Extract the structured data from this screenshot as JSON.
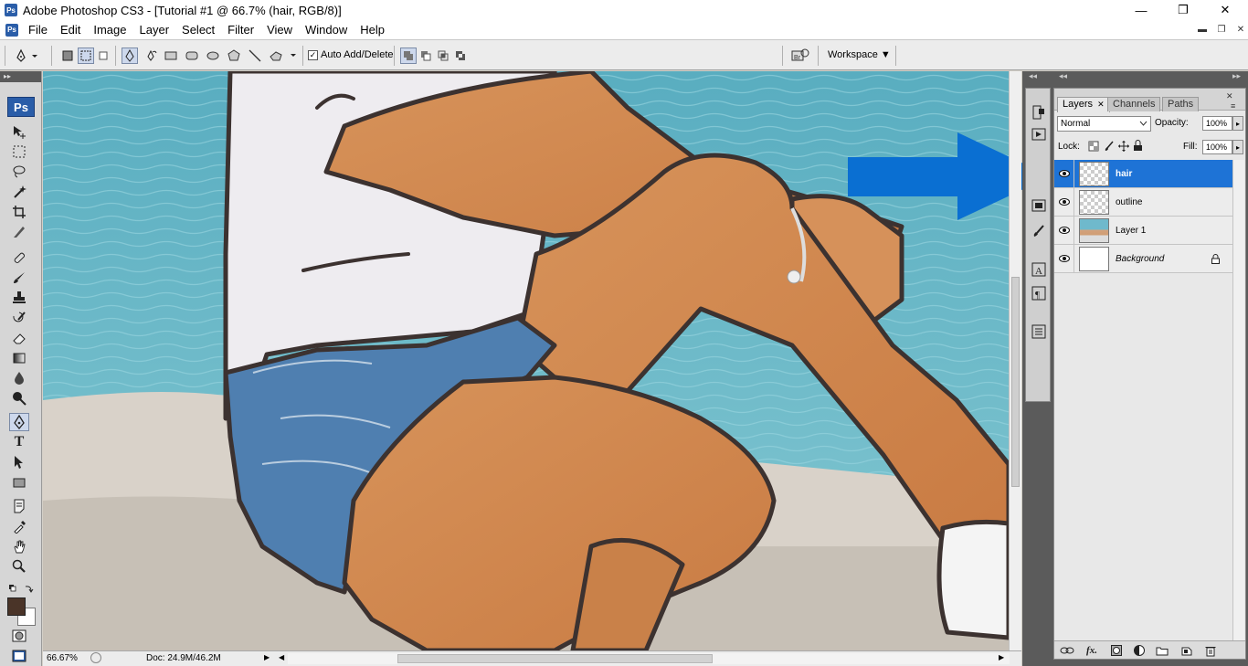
{
  "window": {
    "app_badge": "Ps",
    "title": "Adobe Photoshop CS3 - [Tutorial #1 @ 66.7% (hair, RGB/8)]",
    "controls": {
      "minimize": "—",
      "maximize": "❐",
      "close": "✕"
    }
  },
  "menu": {
    "icon": "Ps",
    "items": [
      "File",
      "Edit",
      "Image",
      "Layer",
      "Select",
      "Filter",
      "View",
      "Window",
      "Help"
    ],
    "doc_controls": {
      "minimize": "▬",
      "restore": "❐",
      "close": "✕"
    }
  },
  "options": {
    "auto_add_delete": {
      "label": "Auto Add/Delete",
      "checked": true,
      "check_mark": "✓"
    },
    "workspace_label": "Workspace ▼"
  },
  "tools": {
    "grip": "▸▸",
    "ps_badge": "Ps"
  },
  "status": {
    "zoom": "66.67%",
    "doc_label": "Doc: 24.9M/46.2M",
    "arrow_right": "▶",
    "arrow_left": "◀",
    "scroll_right": "▶"
  },
  "layers_panel": {
    "tabs": [
      {
        "label": "Layers",
        "close": "✕",
        "active": true
      },
      {
        "label": "Channels",
        "active": false
      },
      {
        "label": "Paths",
        "active": false
      }
    ],
    "blend_mode": "Normal",
    "opacity_label": "Opacity:",
    "opacity_value": "100%",
    "lock_label": "Lock:",
    "fill_label": "Fill:",
    "fill_value": "100%",
    "layers": [
      {
        "name": "hair",
        "selected": true,
        "thumb": "transparent",
        "visible": true
      },
      {
        "name": "outline",
        "selected": false,
        "thumb": "transparent",
        "visible": true
      },
      {
        "name": "Layer 1",
        "selected": false,
        "thumb": "photo",
        "visible": true
      },
      {
        "name": "Background",
        "selected": false,
        "thumb": "white",
        "visible": true,
        "locked": true
      }
    ]
  },
  "colors": {
    "selected_layer": "#1e73d6",
    "annotation_arrow": "#0a6fd2",
    "foreground_swatch": "#4a3428",
    "background_swatch": "#ffffff"
  }
}
